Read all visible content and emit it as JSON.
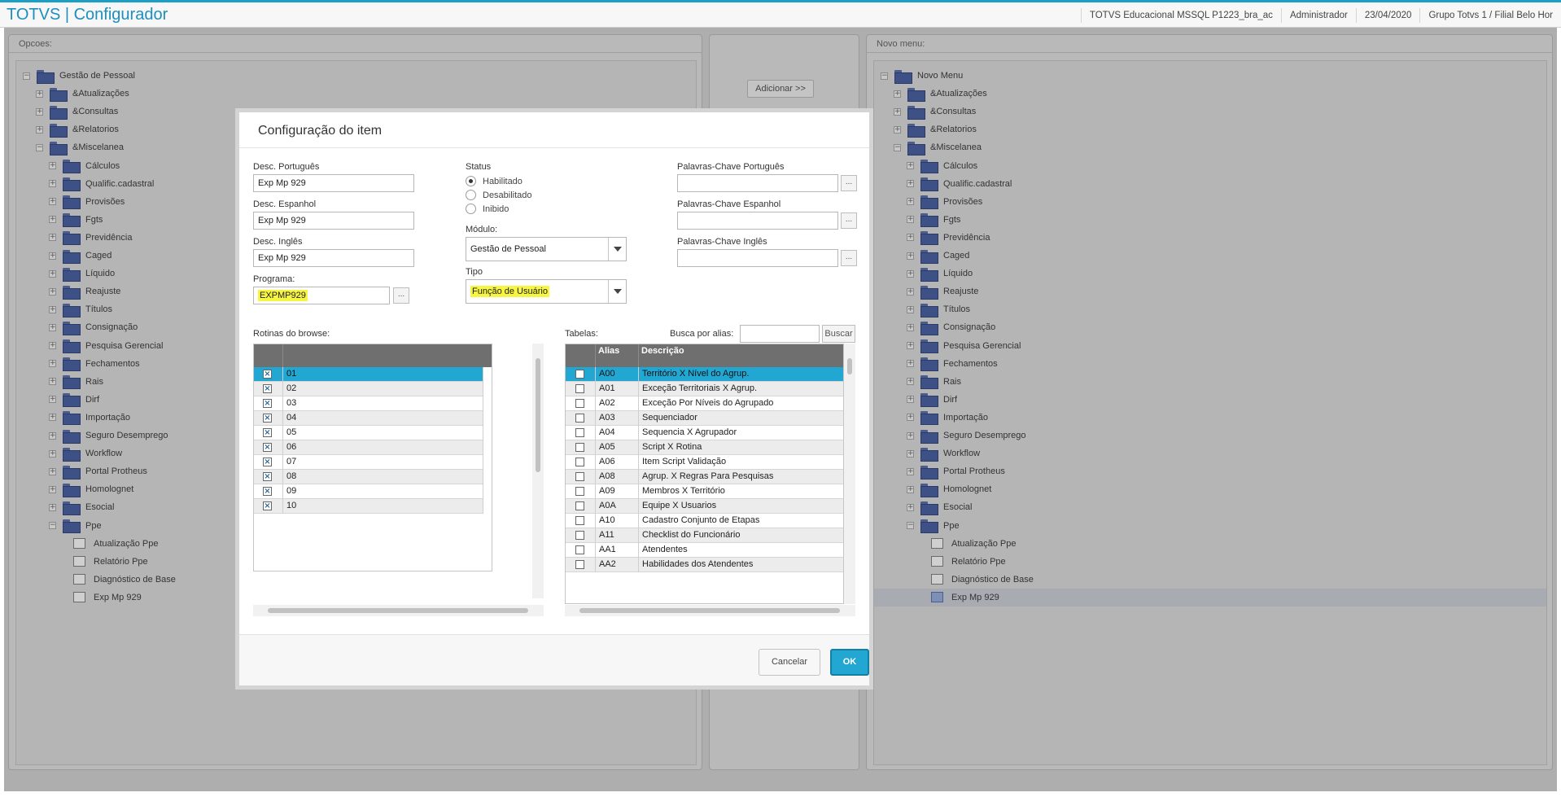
{
  "header": {
    "app_title": "TOTVS | Configurador",
    "system": "TOTVS Educacional MSSQL P1223_bra_ac",
    "user": "Administrador",
    "date": "23/04/2020",
    "company": "Grupo Totvs 1 / Filial Belo Hor"
  },
  "left_panel": {
    "title": "Opcoes:",
    "root": "Gestão de Pessoal",
    "level1": [
      "&Atualizações",
      "&Consultas",
      "&Relatorios",
      "&Miscelanea"
    ],
    "misc_children": [
      "Cálculos",
      "Qualific.cadastral",
      "Provisões",
      "Fgts",
      "Previdência",
      "Caged",
      "Líquido",
      "Reajuste",
      "Títulos",
      "Consignação",
      "Pesquisa Gerencial",
      "Fechamentos",
      "Rais",
      "Dirf",
      "Importação",
      "Seguro Desemprego",
      "Workflow",
      "Portal Protheus",
      "Homolognet",
      "Esocial",
      "Ppe"
    ],
    "ppe_children": [
      "Atualização Ppe",
      "Relatório Ppe",
      "Diagnóstico de Base",
      "Exp Mp 929"
    ]
  },
  "middle_panel": {
    "add_button": "Adicionar >>"
  },
  "right_panel": {
    "title": "Novo menu:",
    "root": "Novo Menu",
    "level1": [
      "&Atualizações",
      "&Consultas",
      "&Relatorios",
      "&Miscelanea"
    ],
    "misc_children": [
      "Cálculos",
      "Qualific.cadastral",
      "Provisões",
      "Fgts",
      "Previdência",
      "Caged",
      "Líquido",
      "Reajuste",
      "Títulos",
      "Consignação",
      "Pesquisa Gerencial",
      "Fechamentos",
      "Rais",
      "Dirf",
      "Importação",
      "Seguro Desemprego",
      "Workflow",
      "Portal Protheus",
      "Homolognet",
      "Esocial",
      "Ppe"
    ],
    "ppe_children": [
      "Atualização Ppe",
      "Relatório Ppe",
      "Diagnóstico de Base",
      "Exp Mp 929"
    ]
  },
  "modal": {
    "title": "Configuração do item",
    "desc_pt_label": "Desc. Português",
    "desc_pt_value": "Exp Mp 929",
    "desc_es_label": "Desc. Espanhol",
    "desc_es_value": "Exp Mp 929",
    "desc_en_label": "Desc. Inglês",
    "desc_en_value": "Exp Mp 929",
    "programa_label": "Programa:",
    "programa_value": "EXPMP929",
    "dots": "...",
    "status_label": "Status",
    "status_options": [
      "Habilitado",
      "Desabilitado",
      "Inibido"
    ],
    "status_selected": "Habilitado",
    "modulo_label": "Módulo:",
    "modulo_value": "Gestão de Pessoal",
    "tipo_label": "Tipo",
    "tipo_value": "Função de Usuário",
    "kw_pt_label": "Palavras-Chave Português",
    "kw_es_label": "Palavras-Chave Espanhol",
    "kw_en_label": "Palavras-Chave Inglês",
    "rotinas_label": "Rotinas do browse:",
    "rotinas": [
      "01",
      "02",
      "03",
      "04",
      "05",
      "06",
      "07",
      "08",
      "09",
      "10"
    ],
    "tabelas_label": "Tabelas:",
    "busca_label": "Busca por alias:",
    "busca_button": "Buscar",
    "tabelas_headers": [
      "Alias",
      "Descrição"
    ],
    "tabelas_rows": [
      [
        "A00",
        "Território X Nível do Agrup."
      ],
      [
        "A01",
        "Exceção Territoriais X Agrup."
      ],
      [
        "A02",
        "Exceção Por Níveis do Agrupado"
      ],
      [
        "A03",
        "Sequenciador"
      ],
      [
        "A04",
        "Sequencia X Agrupador"
      ],
      [
        "A05",
        "Script X Rotina"
      ],
      [
        "A06",
        "Item Script Validação"
      ],
      [
        "A08",
        "Agrup. X Regras Para Pesquisas"
      ],
      [
        "A09",
        "Membros X Território"
      ],
      [
        "A0A",
        "Equipe X Usuarios"
      ],
      [
        "A10",
        "Cadastro Conjunto de Etapas"
      ],
      [
        "A11",
        "Checklist do Funcionário"
      ],
      [
        "AA1",
        "Atendentes"
      ],
      [
        "AA2",
        "Habilidades dos Atendentes"
      ]
    ],
    "cancel_button": "Cancelar",
    "ok_button": "OK"
  },
  "colors": {
    "accent": "#22a7d3",
    "title": "#1c8fbf",
    "highlight": "#f5f542"
  }
}
